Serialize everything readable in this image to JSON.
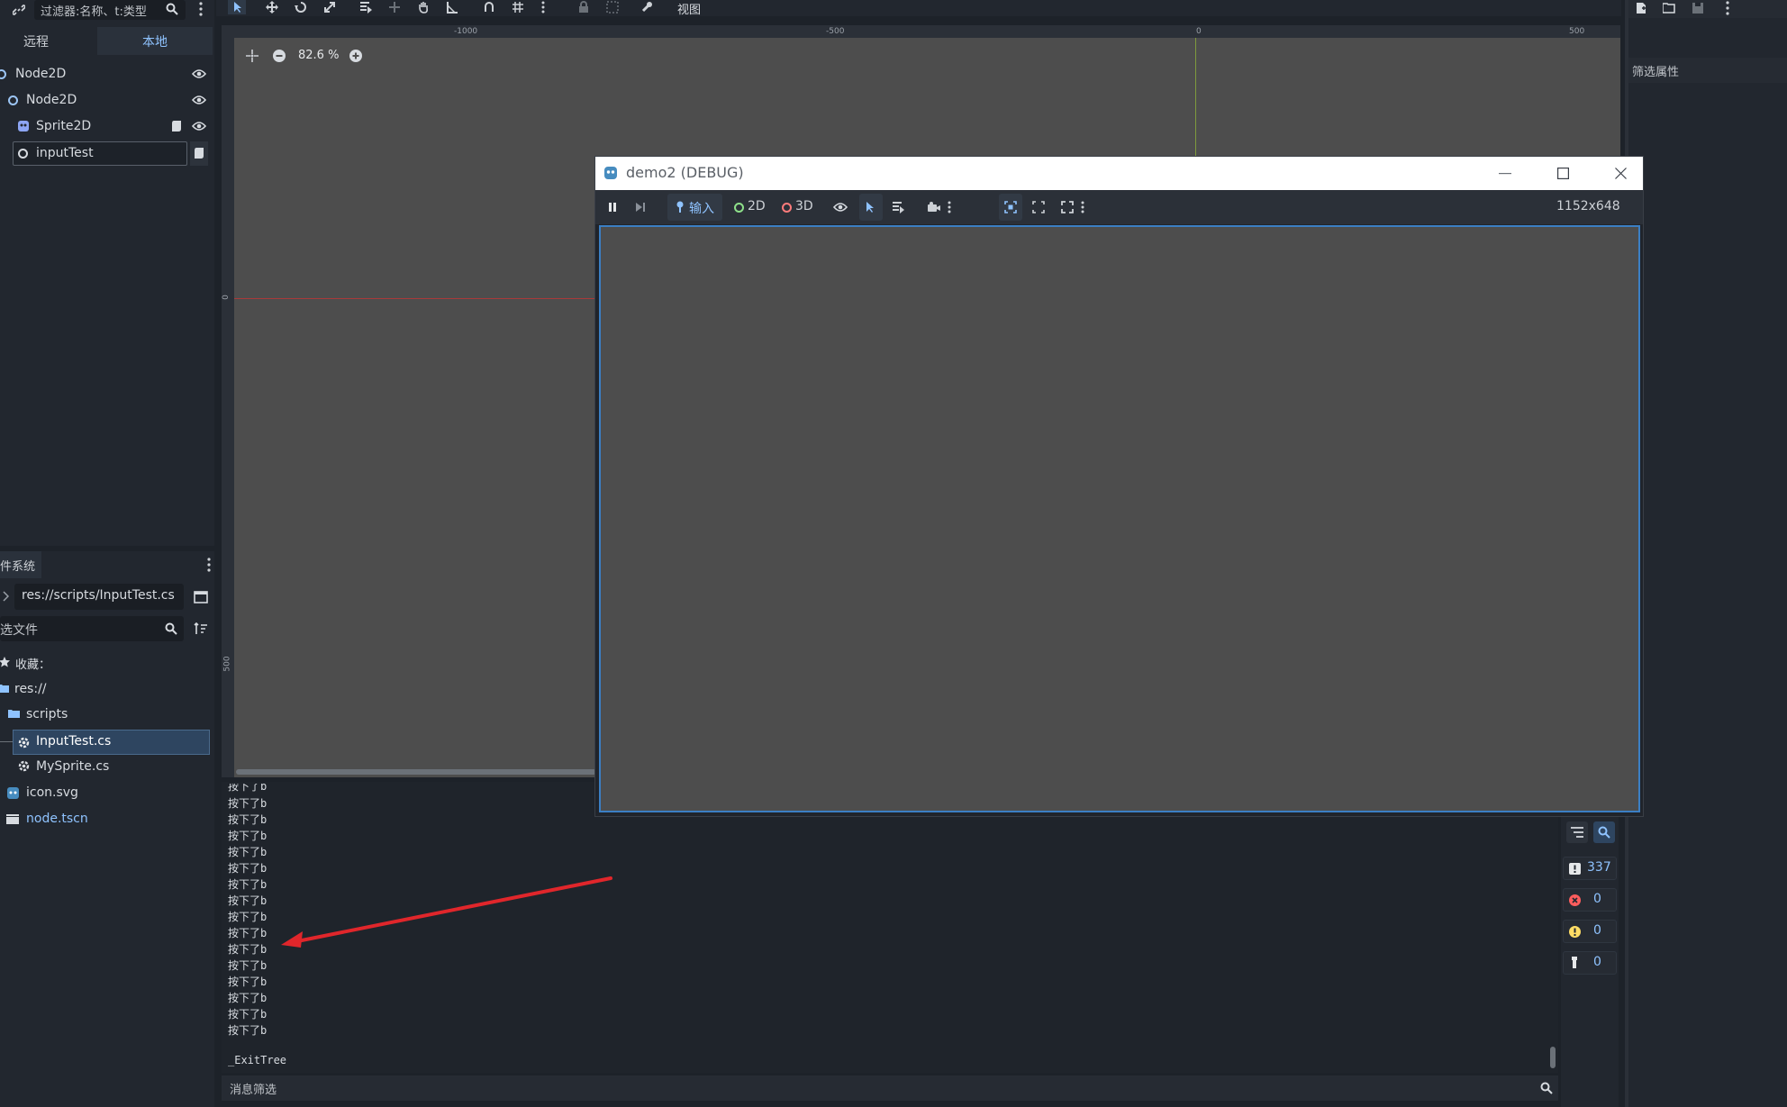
{
  "scene_dock": {
    "filter_placeholder": "过滤器:名称、t:类型",
    "tabs": [
      "远程",
      "本地"
    ],
    "active_tab": "本地",
    "nodes": [
      {
        "label": "Node2D",
        "icon": "node2d-circle-icon",
        "eye": true
      },
      {
        "label": "Node2D",
        "icon": "node2d-circle-icon",
        "eye": true
      },
      {
        "label": "Sprite2D",
        "icon": "sprite2d-icon",
        "eye": true,
        "script": true
      },
      {
        "label": "inputTest",
        "icon": "node-circle-icon",
        "script": true,
        "selected": true
      }
    ]
  },
  "filesystem": {
    "title": "件系统",
    "path": "res://scripts/InputTest.cs",
    "filter_placeholder": "选文件",
    "items": [
      {
        "label": "收藏：",
        "icon": "star-icon"
      },
      {
        "label": "res://",
        "icon": "folder-icon"
      },
      {
        "label": "scripts",
        "icon": "folder-icon"
      },
      {
        "label": "InputTest.cs",
        "icon": "cs-gear-icon",
        "selected": true
      },
      {
        "label": "MySprite.cs",
        "icon": "cs-gear-icon"
      },
      {
        "label": "icon.svg",
        "icon": "godot-icon"
      },
      {
        "label": "node.tscn",
        "icon": "clapper-icon",
        "link": true
      }
    ]
  },
  "viewport": {
    "menu_view": "视图",
    "zoom": "82.6 %",
    "ruler_top": [
      "-1000",
      "-500",
      "0",
      "500"
    ],
    "ruler_left": [
      "0",
      "500"
    ]
  },
  "debug_window": {
    "title": "demo2 (DEBUG)",
    "input_label": "输入",
    "mode_2d": "2D",
    "mode_3d": "3D",
    "resolution": "1152x648"
  },
  "output": {
    "lines": [
      "按下了b",
      "按下了b",
      "按下了b",
      "按下了b",
      "按下了b",
      "按下了b",
      "按下了b",
      "按下了b",
      "按下了b",
      "按下了b",
      "按下了b",
      "按下了b",
      "按下了b",
      "按下了b",
      "按下了b",
      "按下了b",
      "_ExitTree"
    ],
    "filter_placeholder": "消息筛选",
    "counts": {
      "messages": "337",
      "errors": "0",
      "warnings": "0",
      "info": "0"
    }
  },
  "inspector": {
    "filter_placeholder": "筛选属性"
  },
  "colors": {
    "accent": "#3b7fc4",
    "panel": "#22272f",
    "viewport": "#4d4d4d",
    "annotation_arrow": "#e0262b"
  }
}
